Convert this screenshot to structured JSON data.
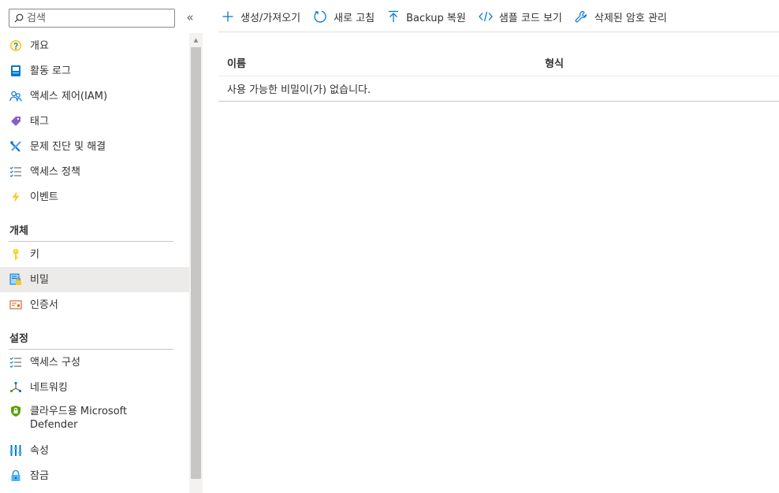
{
  "search": {
    "placeholder": "검색"
  },
  "collapse_label": "«",
  "sidebar": {
    "top_items": [
      {
        "label": "개요",
        "icon": "overview-icon"
      },
      {
        "label": "활동 로그",
        "icon": "activity-log-icon"
      },
      {
        "label": "액세스 제어(IAM)",
        "icon": "iam-icon"
      },
      {
        "label": "태그",
        "icon": "tag-icon"
      },
      {
        "label": "문제 진단 및 해결",
        "icon": "diagnose-icon"
      },
      {
        "label": "액세스 정책",
        "icon": "access-policy-icon"
      },
      {
        "label": "이벤트",
        "icon": "events-icon"
      }
    ],
    "objects_header": "개체",
    "objects_items": [
      {
        "label": "키",
        "icon": "key-icon"
      },
      {
        "label": "비밀",
        "icon": "secret-icon",
        "selected": true
      },
      {
        "label": "인증서",
        "icon": "certificate-icon"
      }
    ],
    "settings_header": "설정",
    "settings_items": [
      {
        "label": "액세스 구성",
        "icon": "access-config-icon"
      },
      {
        "label": "네트워킹",
        "icon": "networking-icon"
      },
      {
        "label": "클라우드용 Microsoft Defender",
        "icon": "defender-shield-icon"
      },
      {
        "label": "속성",
        "icon": "properties-icon"
      },
      {
        "label": "잠금",
        "icon": "lock-icon"
      }
    ]
  },
  "toolbar": {
    "create_label": "생성/가져오기",
    "refresh_label": "새로 고침",
    "backup_label": "Backup 복원",
    "sample_label": "샘플 코드 보기",
    "deleted_label": "삭제된 암호 관리"
  },
  "grid": {
    "columns": [
      "이름",
      "형식"
    ],
    "empty_message": "사용 가능한 비밀이(가) 없습니다."
  },
  "colors": {
    "accent": "#0078d4",
    "selected_bg": "#edebe9",
    "key_yellow": "#f8d22a",
    "lightning": "#f8c828",
    "tag_purple": "#8661c5",
    "shield_green": "#57a300"
  }
}
